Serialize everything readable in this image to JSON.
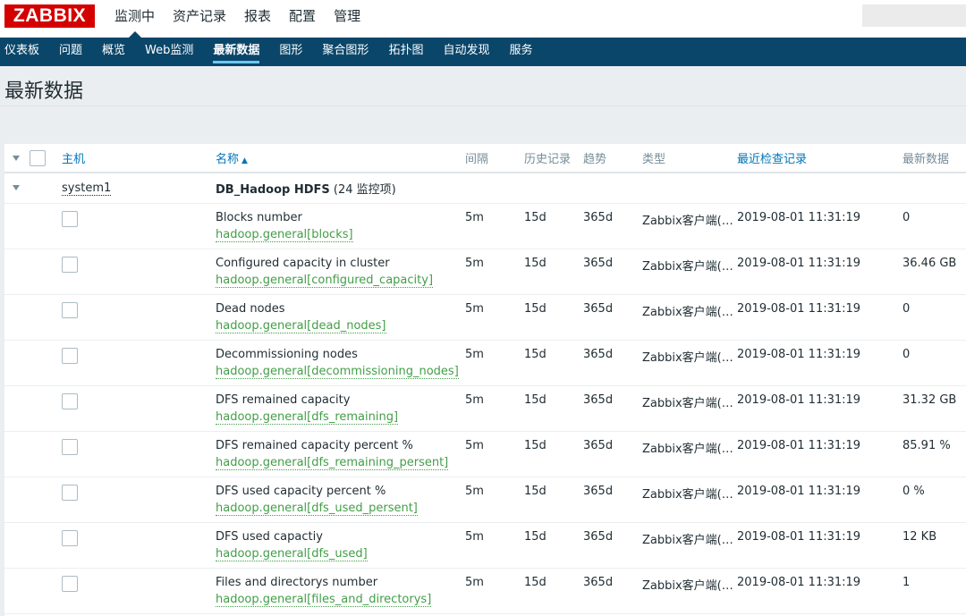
{
  "logo": "ZABBIX",
  "main_menu": [
    {
      "label": "监测中",
      "active": true
    },
    {
      "label": "资产记录",
      "active": false
    },
    {
      "label": "报表",
      "active": false
    },
    {
      "label": "配置",
      "active": false
    },
    {
      "label": "管理",
      "active": false
    }
  ],
  "sub_menu": [
    {
      "label": "仪表板",
      "active": false
    },
    {
      "label": "问题",
      "active": false
    },
    {
      "label": "概览",
      "active": false
    },
    {
      "label": "Web监测",
      "active": false
    },
    {
      "label": "最新数据",
      "active": true
    },
    {
      "label": "图形",
      "active": false
    },
    {
      "label": "聚合图形",
      "active": false
    },
    {
      "label": "拓扑图",
      "active": false
    },
    {
      "label": "自动发现",
      "active": false
    },
    {
      "label": "服务",
      "active": false
    }
  ],
  "page_title": "最新数据",
  "table": {
    "headers": {
      "host": "主机",
      "name": "名称",
      "interval": "间隔",
      "history": "历史记录",
      "trends": "趋势",
      "type": "类型",
      "last_check": "最近检查记录",
      "last_value": "最新数据"
    },
    "sort_arrow": "▲",
    "group": {
      "host": "system1",
      "application": "DB_Hadoop HDFS",
      "count": "(24 监控项)"
    },
    "rows": [
      {
        "name": "Blocks number",
        "key": "hadoop.general[blocks]",
        "interval": "5m",
        "history": "15d",
        "trends": "365d",
        "type": "Zabbix客户端(…",
        "last_check": "2019-08-01 11:31:19",
        "last_value": "0"
      },
      {
        "name": "Configured capacity in cluster",
        "key": "hadoop.general[configured_capacity]",
        "interval": "5m",
        "history": "15d",
        "trends": "365d",
        "type": "Zabbix客户端(…",
        "last_check": "2019-08-01 11:31:19",
        "last_value": "36.46 GB"
      },
      {
        "name": "Dead nodes",
        "key": "hadoop.general[dead_nodes]",
        "interval": "5m",
        "history": "15d",
        "trends": "365d",
        "type": "Zabbix客户端(…",
        "last_check": "2019-08-01 11:31:19",
        "last_value": "0"
      },
      {
        "name": "Decommissioning nodes",
        "key": "hadoop.general[decommissioning_nodes]",
        "interval": "5m",
        "history": "15d",
        "trends": "365d",
        "type": "Zabbix客户端(…",
        "last_check": "2019-08-01 11:31:19",
        "last_value": "0"
      },
      {
        "name": "DFS remained capacity",
        "key": "hadoop.general[dfs_remaining]",
        "interval": "5m",
        "history": "15d",
        "trends": "365d",
        "type": "Zabbix客户端(…",
        "last_check": "2019-08-01 11:31:19",
        "last_value": "31.32 GB"
      },
      {
        "name": "DFS remained capacity percent %",
        "key": "hadoop.general[dfs_remaining_persent]",
        "interval": "5m",
        "history": "15d",
        "trends": "365d",
        "type": "Zabbix客户端(…",
        "last_check": "2019-08-01 11:31:19",
        "last_value": "85.91 %"
      },
      {
        "name": "DFS used capacity percent %",
        "key": "hadoop.general[dfs_used_persent]",
        "interval": "5m",
        "history": "15d",
        "trends": "365d",
        "type": "Zabbix客户端(…",
        "last_check": "2019-08-01 11:31:19",
        "last_value": "0 %"
      },
      {
        "name": "DFS used capactiy",
        "key": "hadoop.general[dfs_used]",
        "interval": "5m",
        "history": "15d",
        "trends": "365d",
        "type": "Zabbix客户端(…",
        "last_check": "2019-08-01 11:31:19",
        "last_value": "12 KB"
      },
      {
        "name": "Files and directorys number",
        "key": "hadoop.general[files_and_directorys]",
        "interval": "5m",
        "history": "15d",
        "trends": "365d",
        "type": "Zabbix客户端(…",
        "last_check": "2019-08-01 11:31:19",
        "last_value": "1"
      }
    ]
  },
  "colors": {
    "brand": "#d40000",
    "nav_bg": "#0a466a",
    "link": "#0275b8",
    "item_key": "#429e47"
  }
}
